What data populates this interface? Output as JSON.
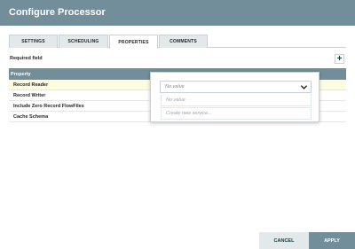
{
  "dialog": {
    "title": "Configure Processor"
  },
  "tabs": [
    {
      "label": "SETTINGS",
      "active": false
    },
    {
      "label": "SCHEDULING",
      "active": false
    },
    {
      "label": "PROPERTIES",
      "active": true
    },
    {
      "label": "COMMENTS",
      "active": false
    }
  ],
  "properties": {
    "required_label": "Required field",
    "add_icon": "plus-icon",
    "column_header": "Property",
    "rows": [
      {
        "name": "Record Reader",
        "selected": true
      },
      {
        "name": "Record Writer"
      },
      {
        "name": "Include Zero Record FlowFiles"
      },
      {
        "name": "Cache Schema",
        "help_icon": "?"
      }
    ]
  },
  "combo": {
    "value": "No value",
    "options": [
      "No value",
      "Create new service..."
    ]
  },
  "footer": {
    "cancel_label": "CANCEL",
    "apply_label": "APPLY"
  },
  "colors": {
    "header": "#728e9b",
    "accent": "#004849",
    "selected_row": "#fdfbe0"
  }
}
